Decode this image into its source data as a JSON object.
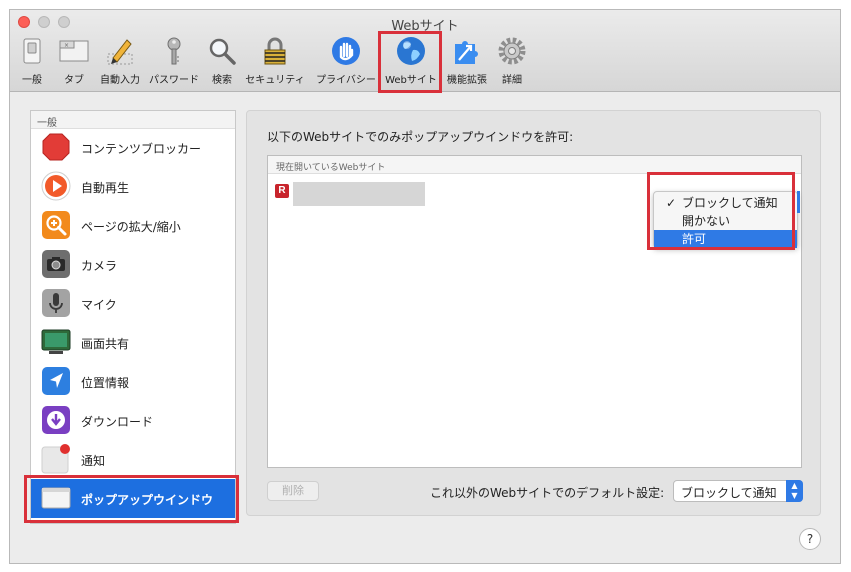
{
  "window": {
    "title": "Webサイト"
  },
  "toolbar": {
    "items": [
      {
        "label": "一般",
        "icon": "switch-icon"
      },
      {
        "label": "タブ",
        "icon": "tabs-icon"
      },
      {
        "label": "自動入力",
        "icon": "pencil-icon"
      },
      {
        "label": "パスワード",
        "icon": "key-icon"
      },
      {
        "label": "検索",
        "icon": "magnifier-icon"
      },
      {
        "label": "セキュリティ",
        "icon": "lock-icon"
      },
      {
        "label": "プライバシー",
        "icon": "hand-icon"
      },
      {
        "label": "Webサイト",
        "icon": "globe-icon",
        "selected": true
      },
      {
        "label": "機能拡張",
        "icon": "puzzle-icon"
      },
      {
        "label": "詳細",
        "icon": "gear-icon"
      }
    ]
  },
  "sidebar": {
    "header": "一般",
    "items": [
      {
        "label": "コンテンツブロッカー",
        "icon": "stop-sign-icon"
      },
      {
        "label": "自動再生",
        "icon": "play-icon"
      },
      {
        "label": "ページの拡大/縮小",
        "icon": "zoom-icon"
      },
      {
        "label": "カメラ",
        "icon": "camera-icon"
      },
      {
        "label": "マイク",
        "icon": "microphone-icon"
      },
      {
        "label": "画面共有",
        "icon": "screen-share-icon"
      },
      {
        "label": "位置情報",
        "icon": "location-icon"
      },
      {
        "label": "ダウンロード",
        "icon": "download-icon"
      },
      {
        "label": "通知",
        "icon": "notification-icon"
      },
      {
        "label": "ポップアップウインドウ",
        "icon": "popup-window-icon",
        "selected": true
      }
    ]
  },
  "main": {
    "title": "以下のWebサイトでのみポップアップウインドウを許可:",
    "list_header": "現在開いているWebサイト",
    "site_favicon_letter": "R",
    "popup_menu": {
      "options": [
        "ブロックして通知",
        "開かない",
        "許可"
      ],
      "checked_index": 0,
      "highlighted_index": 2,
      "check_mark": "✓"
    },
    "delete_button": "削除",
    "default_label": "これ以外のWebサイトでのデフォルト設定:",
    "default_value": "ブロックして通知"
  },
  "help_button": "?",
  "colors": {
    "accent": "#2f7ae5",
    "highlight_box": "#d9303a",
    "selected_sidebar": "#1d6fe0"
  }
}
